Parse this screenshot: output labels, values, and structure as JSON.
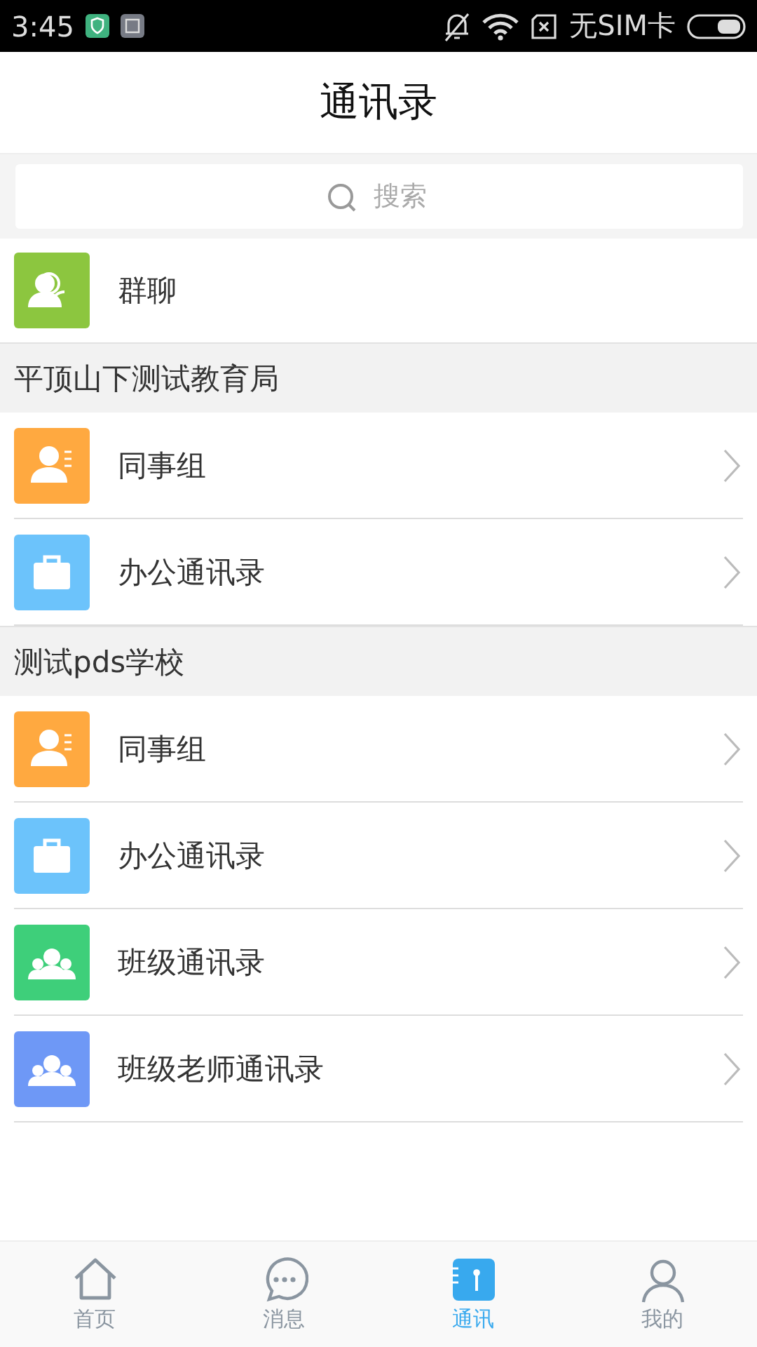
{
  "status_bar": {
    "time": "3:45",
    "carrier": "无SIM卡"
  },
  "header": {
    "title": "通讯录"
  },
  "search": {
    "placeholder": "搜索"
  },
  "top_items": [
    {
      "label": "群聊",
      "kind": "group-chat",
      "color": "#8cc63f",
      "chevron": false
    }
  ],
  "sections": [
    {
      "title": "平顶山下测试教育局",
      "items": [
        {
          "label": "同事组",
          "kind": "colleagues",
          "color": "#ffa940",
          "chevron": true
        },
        {
          "label": "办公通讯录",
          "kind": "briefcase",
          "color": "#6cc3fb",
          "chevron": true
        }
      ]
    },
    {
      "title": "测试pds学校",
      "items": [
        {
          "label": "同事组",
          "kind": "colleagues",
          "color": "#ffa940",
          "chevron": true
        },
        {
          "label": "办公通讯录",
          "kind": "briefcase",
          "color": "#6cc3fb",
          "chevron": true
        },
        {
          "label": "班级通讯录",
          "kind": "people",
          "color": "#3ecf7a",
          "chevron": true
        },
        {
          "label": "班级老师通讯录",
          "kind": "people",
          "color": "#6e98f6",
          "chevron": true
        }
      ]
    }
  ],
  "tab_bar": [
    {
      "label": "首页",
      "kind": "home",
      "selected": false
    },
    {
      "label": "消息",
      "kind": "message",
      "selected": false
    },
    {
      "label": "通讯",
      "kind": "contacts",
      "selected": true
    },
    {
      "label": "我的",
      "kind": "profile",
      "selected": false
    }
  ]
}
